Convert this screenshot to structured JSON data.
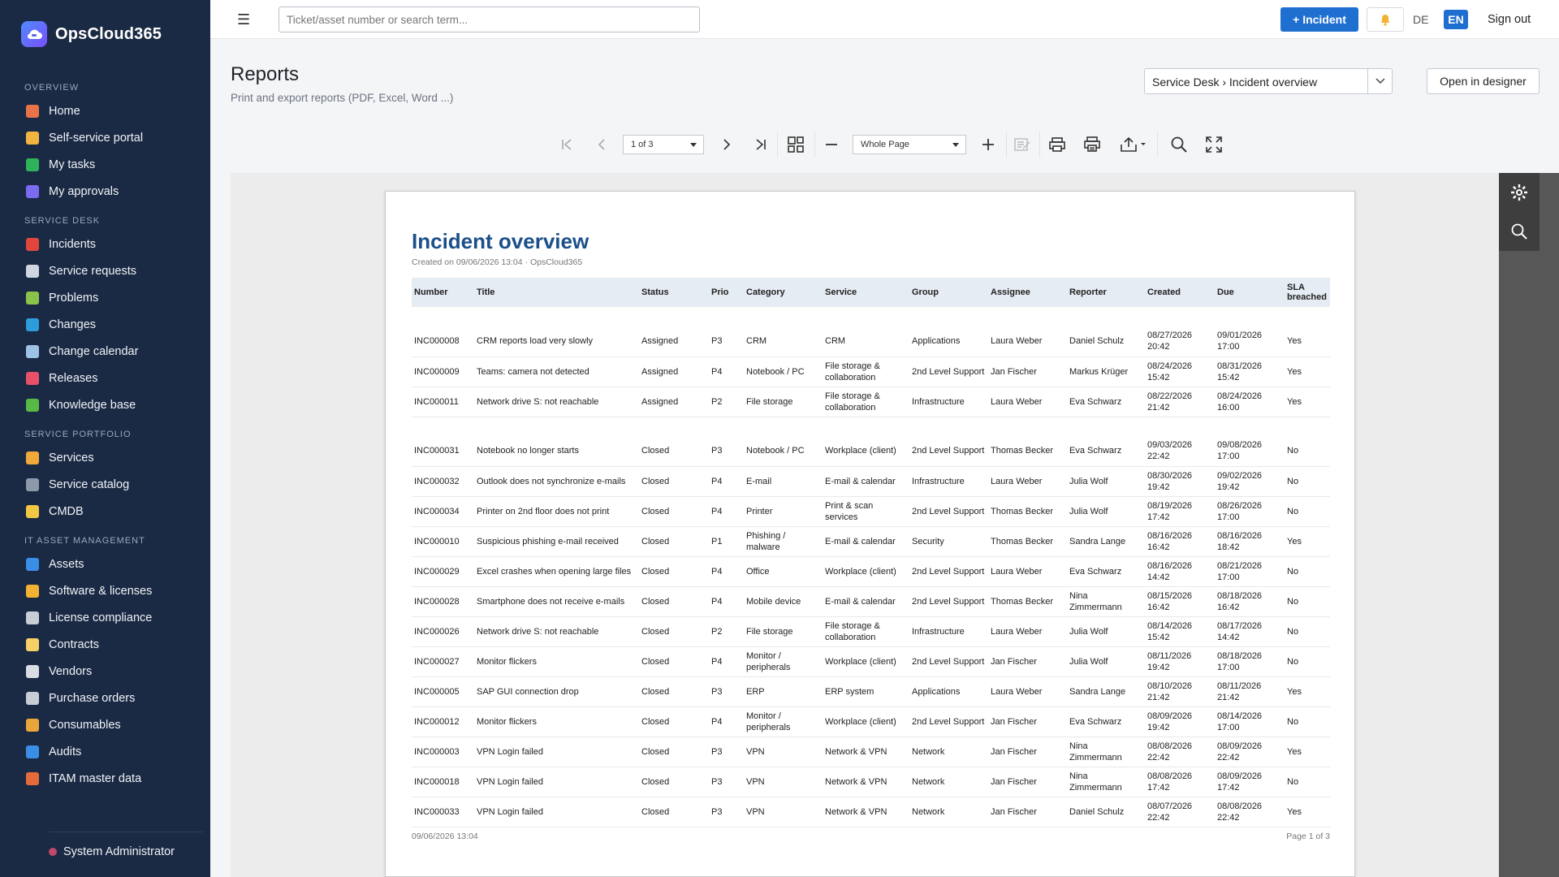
{
  "brand": {
    "name": "OpsCloud365"
  },
  "sidebar": {
    "sections": [
      {
        "title": "OVERVIEW",
        "items": [
          {
            "label": "Home",
            "color": "#e8734a"
          },
          {
            "label": "Self-service portal",
            "color": "#f2b441"
          },
          {
            "label": "My tasks",
            "color": "#2fb35a"
          },
          {
            "label": "My approvals",
            "color": "#7a6cf0"
          }
        ]
      },
      {
        "title": "SERVICE DESK",
        "items": [
          {
            "label": "Incidents",
            "color": "#e0463b"
          },
          {
            "label": "Service requests",
            "color": "#cfd6e0"
          },
          {
            "label": "Problems",
            "color": "#8bc34a"
          },
          {
            "label": "Changes",
            "color": "#2d9cdb"
          },
          {
            "label": "Change calendar",
            "color": "#9ec1e6"
          },
          {
            "label": "Releases",
            "color": "#e8506a"
          },
          {
            "label": "Knowledge base",
            "color": "#58b947"
          }
        ]
      },
      {
        "title": "SERVICE PORTFOLIO",
        "items": [
          {
            "label": "Services",
            "color": "#f2a93b"
          },
          {
            "label": "Service catalog",
            "color": "#8d99aa"
          },
          {
            "label": "CMDB",
            "color": "#f2c744"
          }
        ]
      },
      {
        "title": "IT ASSET MANAGEMENT",
        "items": [
          {
            "label": "Assets",
            "color": "#3a8ee6"
          },
          {
            "label": "Software & licenses",
            "color": "#f2b233"
          },
          {
            "label": "License compliance",
            "color": "#c9ced6"
          },
          {
            "label": "Contracts",
            "color": "#f6d067"
          },
          {
            "label": "Vendors",
            "color": "#d9dde4"
          },
          {
            "label": "Purchase orders",
            "color": "#c9ced6"
          },
          {
            "label": "Consumables",
            "color": "#e9a73b"
          },
          {
            "label": "Audits",
            "color": "#3a8ee6"
          },
          {
            "label": "ITAM master data",
            "color": "#e66b3a"
          }
        ]
      }
    ],
    "user": "System Administrator"
  },
  "topbar": {
    "search_placeholder": "Ticket/asset number or search term...",
    "incident_button": "+ Incident",
    "lang_de": "DE",
    "lang_en": "EN",
    "signout": "Sign out"
  },
  "page": {
    "title": "Reports",
    "subtitle": "Print and export reports (PDF, Excel, Word ...)",
    "report_selected": "Service Desk › Incident overview",
    "designer_button": "Open in designer"
  },
  "viewer": {
    "page_select": "1 of 3",
    "zoom_select": "Whole Page"
  },
  "report": {
    "title": "Incident overview",
    "created": "Created on 09/06/2026 13:04  ·  OpsCloud365",
    "footer_left": "09/06/2026 13:04",
    "footer_right": "Page 1 of 3",
    "columns": [
      "Number",
      "Title",
      "Status",
      "Prio",
      "Category",
      "Service",
      "Group",
      "Assignee",
      "Reporter",
      "Created",
      "Due",
      "SLA breached"
    ],
    "groups": [
      {
        "rows": [
          [
            "INC000008",
            "CRM reports load very slowly",
            "Assigned",
            "P3",
            "CRM",
            "CRM",
            "Applications",
            "Laura Weber",
            "Daniel Schulz",
            "08/27/2026 20:42",
            "09/01/2026 17:00",
            "Yes"
          ],
          [
            "INC000009",
            "Teams: camera not detected",
            "Assigned",
            "P4",
            "Notebook / PC",
            "File storage & collaboration",
            "2nd Level Support",
            "Jan Fischer",
            "Markus Krüger",
            "08/24/2026 15:42",
            "08/31/2026 15:42",
            "Yes"
          ],
          [
            "INC000011",
            "Network drive S: not reachable",
            "Assigned",
            "P2",
            "File storage",
            "File storage & collaboration",
            "Infrastructure",
            "Laura Weber",
            "Eva Schwarz",
            "08/22/2026 21:42",
            "08/24/2026 16:00",
            "Yes"
          ]
        ]
      },
      {
        "rows": [
          [
            "INC000031",
            "Notebook no longer starts",
            "Closed",
            "P3",
            "Notebook / PC",
            "Workplace (client)",
            "2nd Level Support",
            "Thomas Becker",
            "Eva Schwarz",
            "09/03/2026 22:42",
            "09/08/2026 17:00",
            "No"
          ],
          [
            "INC000032",
            "Outlook does not synchronize e-mails",
            "Closed",
            "P4",
            "E-mail",
            "E-mail & calendar",
            "Infrastructure",
            "Laura Weber",
            "Julia Wolf",
            "08/30/2026 19:42",
            "09/02/2026 19:42",
            "No"
          ],
          [
            "INC000034",
            "Printer on 2nd floor does not print",
            "Closed",
            "P4",
            "Printer",
            "Print & scan services",
            "2nd Level Support",
            "Thomas Becker",
            "Julia Wolf",
            "08/19/2026 17:42",
            "08/26/2026 17:00",
            "No"
          ],
          [
            "INC000010",
            "Suspicious phishing e-mail received",
            "Closed",
            "P1",
            "Phishing / malware",
            "E-mail & calendar",
            "Security",
            "Thomas Becker",
            "Sandra Lange",
            "08/16/2026 16:42",
            "08/16/2026 18:42",
            "Yes"
          ],
          [
            "INC000029",
            "Excel crashes when opening large files",
            "Closed",
            "P4",
            "Office",
            "Workplace (client)",
            "2nd Level Support",
            "Laura Weber",
            "Eva Schwarz",
            "08/16/2026 14:42",
            "08/21/2026 17:00",
            "No"
          ],
          [
            "INC000028",
            "Smartphone does not receive e-mails",
            "Closed",
            "P4",
            "Mobile device",
            "E-mail & calendar",
            "2nd Level Support",
            "Thomas Becker",
            "Nina Zimmermann",
            "08/15/2026 16:42",
            "08/18/2026 16:42",
            "No"
          ],
          [
            "INC000026",
            "Network drive S: not reachable",
            "Closed",
            "P2",
            "File storage",
            "File storage & collaboration",
            "Infrastructure",
            "Laura Weber",
            "Julia Wolf",
            "08/14/2026 15:42",
            "08/17/2026 14:42",
            "No"
          ],
          [
            "INC000027",
            "Monitor flickers",
            "Closed",
            "P4",
            "Monitor / peripherals",
            "Workplace (client)",
            "2nd Level Support",
            "Jan Fischer",
            "Julia Wolf",
            "08/11/2026 19:42",
            "08/18/2026 17:00",
            "No"
          ],
          [
            "INC000005",
            "SAP GUI connection drop",
            "Closed",
            "P3",
            "ERP",
            "ERP system",
            "Applications",
            "Laura Weber",
            "Sandra Lange",
            "08/10/2026 21:42",
            "08/11/2026 21:42",
            "Yes"
          ],
          [
            "INC000012",
            "Monitor flickers",
            "Closed",
            "P4",
            "Monitor / peripherals",
            "Workplace (client)",
            "2nd Level Support",
            "Jan Fischer",
            "Eva Schwarz",
            "08/09/2026 19:42",
            "08/14/2026 17:00",
            "No"
          ],
          [
            "INC000003",
            "VPN Login failed",
            "Closed",
            "P3",
            "VPN",
            "Network & VPN",
            "Network",
            "Jan Fischer",
            "Nina Zimmermann",
            "08/08/2026 22:42",
            "08/09/2026 22:42",
            "Yes"
          ],
          [
            "INC000018",
            "VPN Login failed",
            "Closed",
            "P3",
            "VPN",
            "Network & VPN",
            "Network",
            "Jan Fischer",
            "Nina Zimmermann",
            "08/08/2026 17:42",
            "08/09/2026 17:42",
            "No"
          ],
          [
            "INC000033",
            "VPN Login failed",
            "Closed",
            "P3",
            "VPN",
            "Network & VPN",
            "Network",
            "Jan Fischer",
            "Daniel Schulz",
            "08/07/2026 22:42",
            "08/08/2026 22:42",
            "Yes"
          ]
        ]
      }
    ]
  }
}
